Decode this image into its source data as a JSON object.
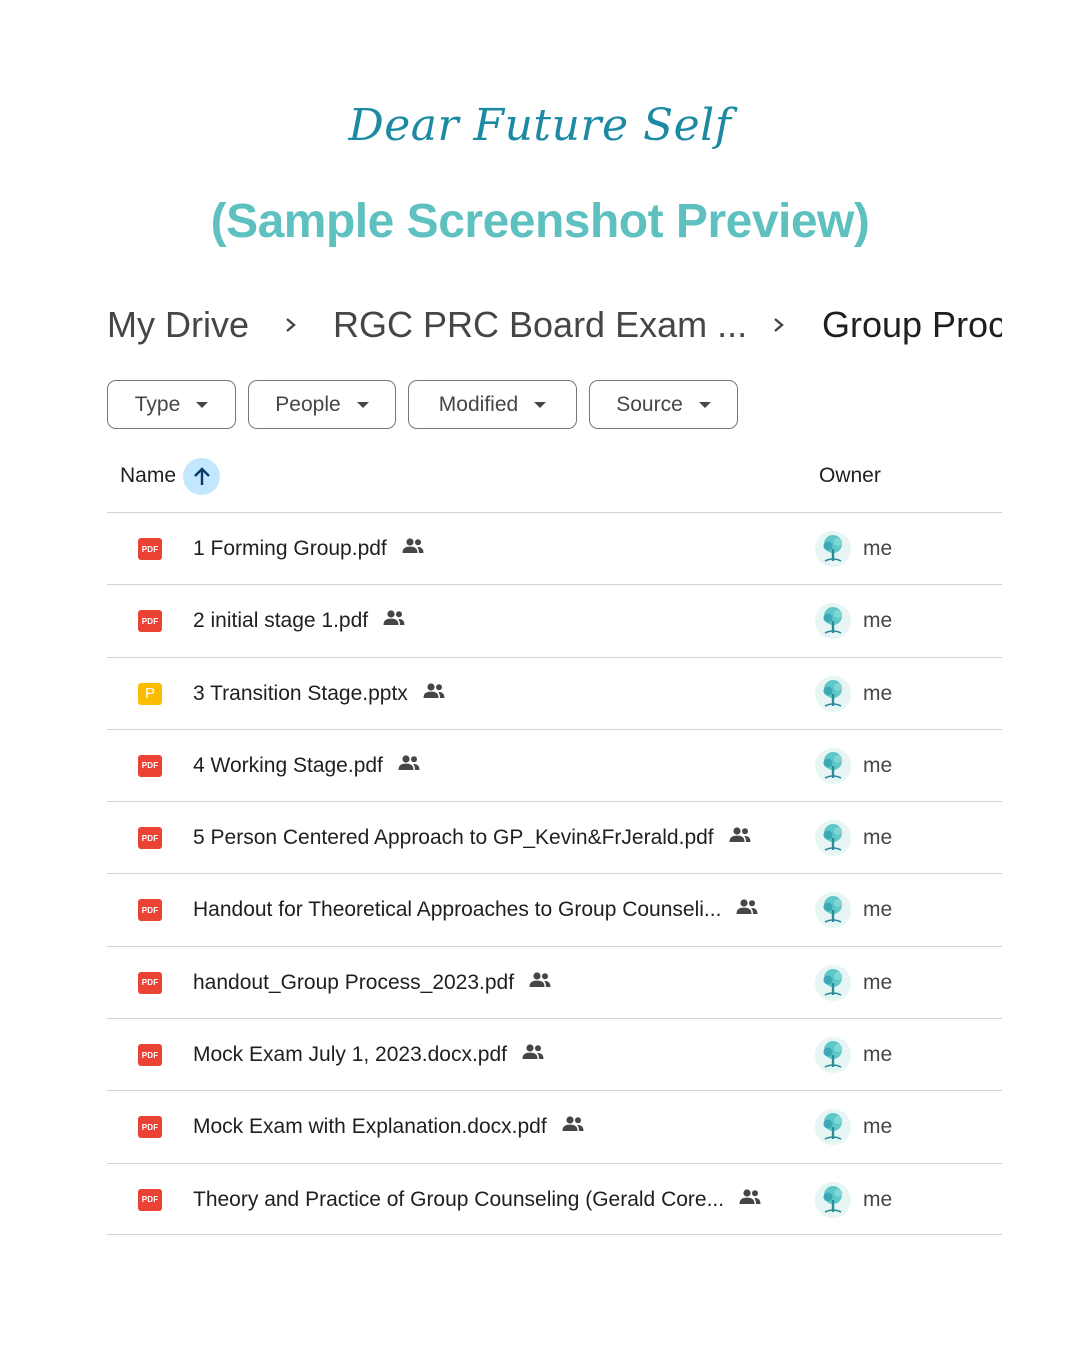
{
  "header": {
    "script_title": "Dear Future Self",
    "preview_title": "(Sample Screenshot Preview)"
  },
  "breadcrumb": {
    "items": [
      "My Drive",
      "RGC PRC Board Exam ...",
      "Group Proc"
    ]
  },
  "filters": [
    "Type",
    "People",
    "Modified",
    "Source"
  ],
  "columns": {
    "name": "Name",
    "owner": "Owner"
  },
  "files": [
    {
      "name": "1 Forming Group.pdf",
      "type": "pdf",
      "icon_label": "PDF",
      "owner": "me"
    },
    {
      "name": "2 initial stage 1.pdf",
      "type": "pdf",
      "icon_label": "PDF",
      "owner": "me"
    },
    {
      "name": "3 Transition Stage.pptx",
      "type": "pptx",
      "icon_label": "P",
      "owner": "me"
    },
    {
      "name": "4 Working Stage.pdf",
      "type": "pdf",
      "icon_label": "PDF",
      "owner": "me"
    },
    {
      "name": "5 Person Centered Approach to GP_Kevin&FrJerald.pdf",
      "type": "pdf",
      "icon_label": "PDF",
      "owner": "me"
    },
    {
      "name": "Handout for Theoretical Approaches to Group Counseli...",
      "type": "pdf",
      "icon_label": "PDF",
      "owner": "me"
    },
    {
      "name": "handout_Group Process_2023.pdf",
      "type": "pdf",
      "icon_label": "PDF",
      "owner": "me"
    },
    {
      "name": "Mock Exam July 1, 2023.docx.pdf",
      "type": "pdf",
      "icon_label": "PDF",
      "owner": "me"
    },
    {
      "name": "Mock Exam with Explanation.docx.pdf",
      "type": "pdf",
      "icon_label": "PDF",
      "owner": "me"
    },
    {
      "name": "Theory and Practice of Group Counseling (Gerald Core...",
      "type": "pdf",
      "icon_label": "PDF",
      "owner": "me"
    }
  ],
  "colors": {
    "script_title": "#1c8aa3",
    "preview_title": "#5ec1c0",
    "pdf_icon": "#ea4335",
    "pptx_icon": "#fbbc04",
    "sort_button": "#c2e7ff"
  }
}
